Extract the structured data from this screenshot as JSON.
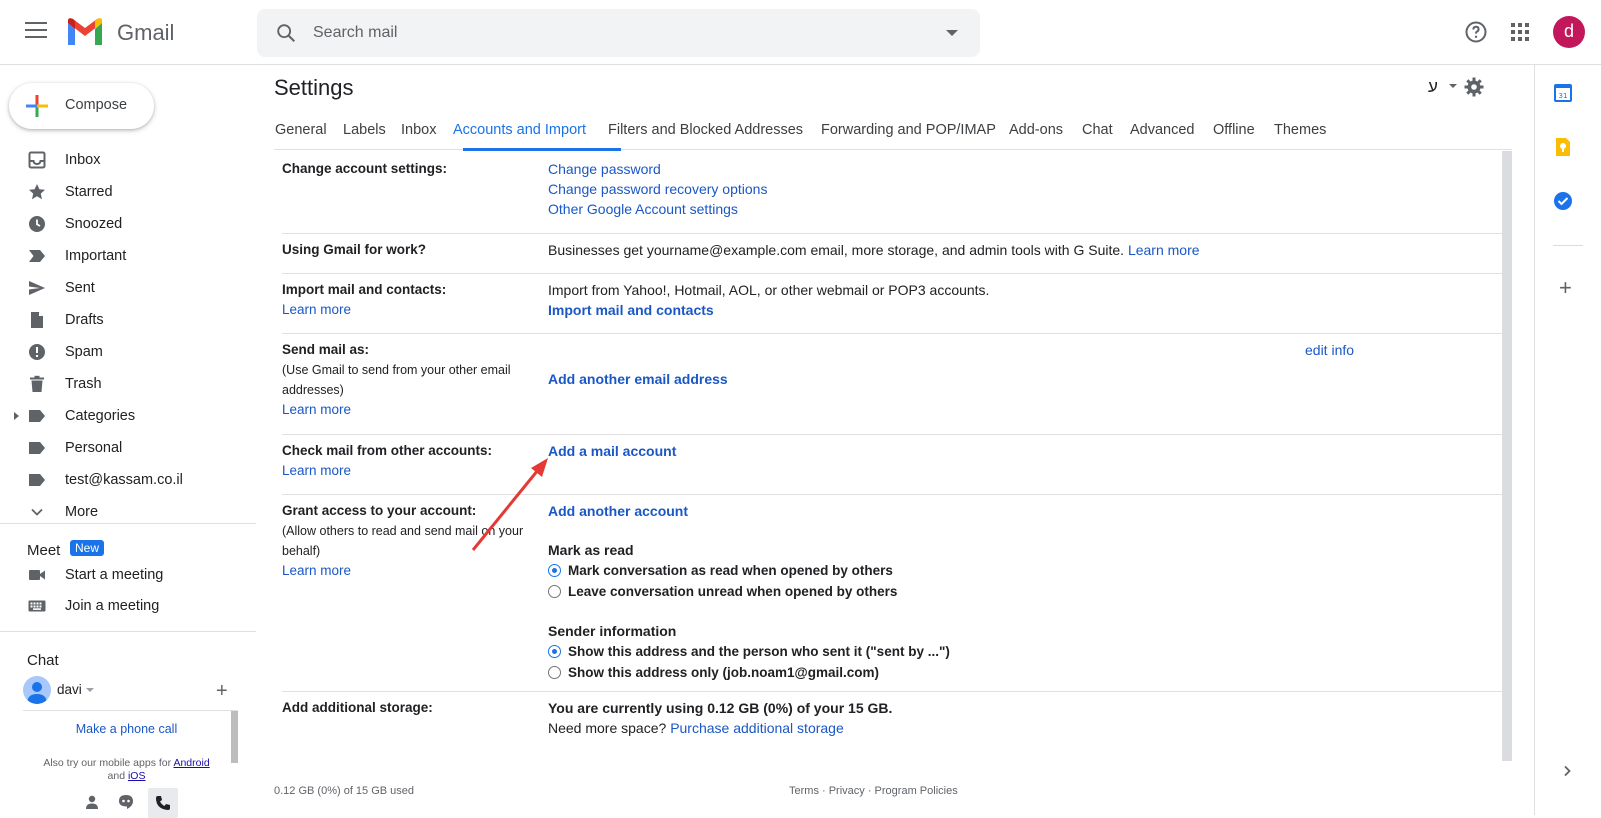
{
  "app": {
    "name": "Gmail",
    "avatar_letter": "d"
  },
  "search": {
    "placeholder": "Search mail"
  },
  "compose": {
    "label": "Compose"
  },
  "nav": [
    {
      "label": "Inbox",
      "icon": "inbox-icon"
    },
    {
      "label": "Starred",
      "icon": "star-icon"
    },
    {
      "label": "Snoozed",
      "icon": "clock-icon"
    },
    {
      "label": "Important",
      "icon": "important-icon"
    },
    {
      "label": "Sent",
      "icon": "send-icon"
    },
    {
      "label": "Drafts",
      "icon": "draft-icon"
    },
    {
      "label": "Spam",
      "icon": "spam-icon"
    },
    {
      "label": "Trash",
      "icon": "trash-icon"
    },
    {
      "label": "Categories",
      "icon": "label-icon"
    },
    {
      "label": "Personal",
      "icon": "label-icon"
    },
    {
      "label": "test@kassam.co.il",
      "icon": "label-icon"
    },
    {
      "label": "More",
      "icon": "chevron-down-icon"
    }
  ],
  "meet": {
    "title": "Meet",
    "badge": "New",
    "start": "Start a meeting",
    "join": "Join a meeting"
  },
  "chat": {
    "title": "Chat",
    "user": "davi",
    "phone_link": "Make a phone call",
    "apps_note_prefix": "Also try our mobile apps for",
    "android": "Android",
    "and": "and",
    "ios": "iOS"
  },
  "settings": {
    "title": "Settings",
    "lang_glyph": "ע",
    "tabs": [
      "General",
      "Labels",
      "Inbox",
      "Accounts and Import",
      "Filters and Blocked Addresses",
      "Forwarding and POP/IMAP",
      "Add-ons",
      "Chat",
      "Advanced",
      "Offline",
      "Themes"
    ],
    "active_tab": "Accounts and Import",
    "rows": {
      "change": {
        "label": "Change account settings:",
        "links": [
          "Change password",
          "Change password recovery options",
          "Other Google Account settings"
        ]
      },
      "work": {
        "label": "Using Gmail for work?",
        "text": "Businesses get yourname@example.com email, more storage, and admin tools with G Suite.",
        "link": "Learn more"
      },
      "import": {
        "label": "Import mail and contacts:",
        "learn": "Learn more",
        "text": "Import from Yahoo!, Hotmail, AOL, or other webmail or POP3 accounts.",
        "action": "Import mail and contacts"
      },
      "sendas": {
        "label": "Send mail as:",
        "sub": "(Use Gmail to send from your other email addresses)",
        "learn": "Learn more",
        "edit": "edit info",
        "action": "Add another email address"
      },
      "check": {
        "label": "Check mail from other accounts:",
        "learn": "Learn more",
        "action": "Add a mail account"
      },
      "grant": {
        "label": "Grant access to your account:",
        "sub": "(Allow others to read and send mail on your behalf)",
        "learn": "Learn more",
        "action": "Add another account",
        "mark_title": "Mark as read",
        "mark_options": [
          "Mark conversation as read when opened by others",
          "Leave conversation unread when opened by others"
        ],
        "sender_title": "Sender information",
        "sender_options": [
          "Show this address and the person who sent it (\"sent by ...\")",
          "Show this address only (job.noam1@gmail.com)"
        ]
      },
      "storage": {
        "label": "Add additional storage:",
        "usage": "You are currently using 0.12 GB (0%) of your 15 GB.",
        "need": "Need more space?",
        "link": "Purchase additional storage"
      }
    },
    "footer": {
      "usage": "0.12 GB (0%) of 15 GB used",
      "links": "Terms · Privacy · Program Policies"
    }
  },
  "colors": {
    "accent": "#1a73e8",
    "link": "#1a57c6",
    "avatar": "#c2185b",
    "arrow": "#e53935"
  }
}
